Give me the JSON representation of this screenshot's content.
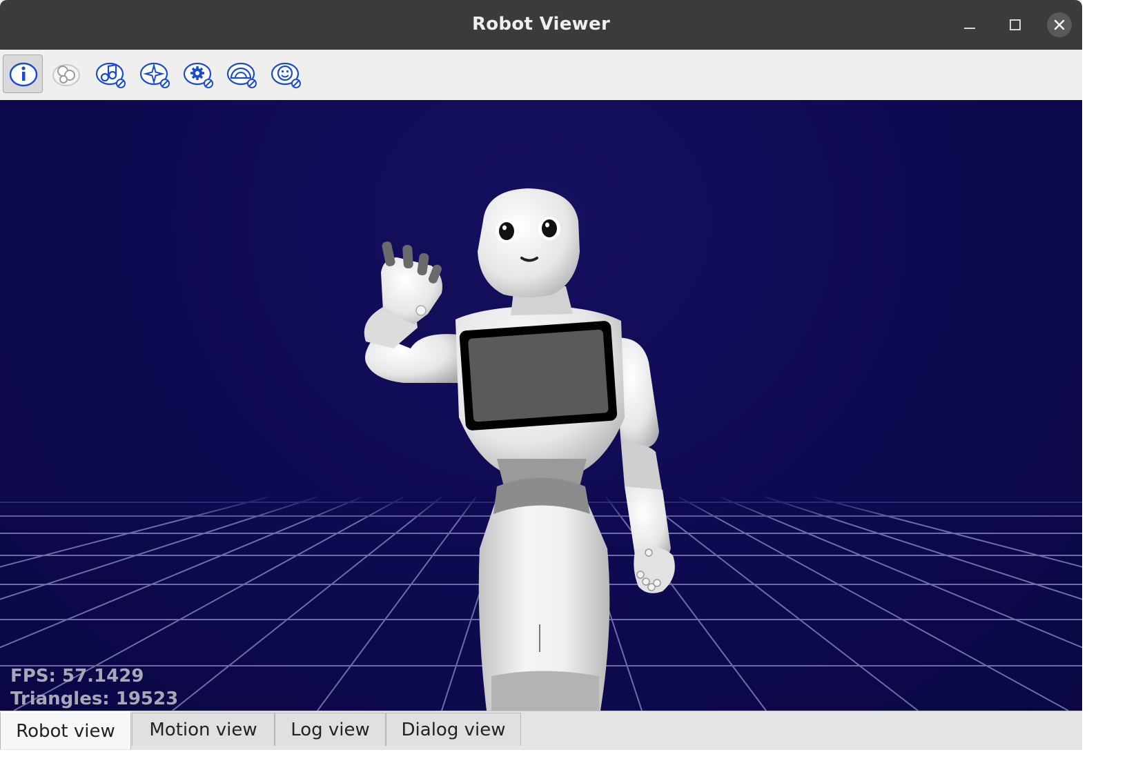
{
  "window": {
    "title": "Robot Viewer"
  },
  "titlebar": {
    "buttons": [
      {
        "name": "minimize",
        "icon": "minimize-icon"
      },
      {
        "name": "maximize",
        "icon": "maximize-icon"
      },
      {
        "name": "close",
        "icon": "close-icon"
      }
    ]
  },
  "toolbar": {
    "tools": [
      {
        "name": "info",
        "icon": "info-icon",
        "active": true
      },
      {
        "name": "chat",
        "icon": "chat-bubbles-icon",
        "active": false
      },
      {
        "name": "music",
        "icon": "music-note-icon",
        "active": false
      },
      {
        "name": "sparkle",
        "icon": "sparkle-icon",
        "active": false
      },
      {
        "name": "settings",
        "icon": "gear-icon",
        "active": false
      },
      {
        "name": "protractor",
        "icon": "protractor-icon",
        "active": false
      },
      {
        "name": "face",
        "icon": "smiley-face-icon",
        "active": false
      }
    ]
  },
  "viewport": {
    "fps_text": "FPS: 57.1429",
    "triangles_text": "Triangles: 19523",
    "background_color": "#0e0a52",
    "grid_color": "#9a9ad0"
  },
  "tabs": [
    {
      "label": "Robot view",
      "active": true
    },
    {
      "label": "Motion view",
      "active": false
    },
    {
      "label": "Log view",
      "active": false
    },
    {
      "label": "Dialog view",
      "active": false
    }
  ]
}
